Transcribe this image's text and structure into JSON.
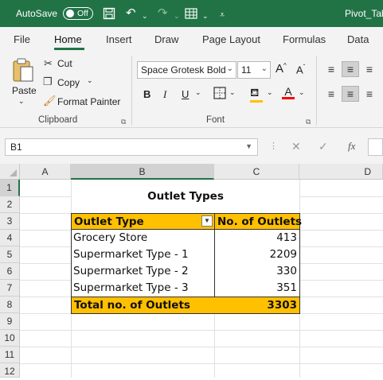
{
  "titlebar": {
    "autosave_label": "AutoSave",
    "autosave_state": "Off",
    "document_title": "Pivot_Tab"
  },
  "tabs": [
    "File",
    "Home",
    "Insert",
    "Draw",
    "Page Layout",
    "Formulas",
    "Data"
  ],
  "active_tab": "Home",
  "ribbon": {
    "clipboard": {
      "paste": "Paste",
      "cut": "Cut",
      "copy": "Copy",
      "format_painter": "Format Painter",
      "label": "Clipboard"
    },
    "font": {
      "font_name": "Space Grotesk Bold",
      "font_size": "11",
      "bold": "B",
      "italic": "I",
      "underline": "U",
      "font_color_glyph": "A",
      "grow_glyph": "A",
      "shrink_glyph": "A",
      "label": "Font"
    }
  },
  "formula_bar": {
    "name_box": "B1",
    "fx": "fx",
    "value": ""
  },
  "columns": [
    "A",
    "B",
    "C",
    "D"
  ],
  "rows": [
    "1",
    "2",
    "3",
    "4",
    "5",
    "6",
    "7",
    "8",
    "9",
    "10",
    "11",
    "12"
  ],
  "sheet": {
    "title": "Outlet Types",
    "header": {
      "col1": "Outlet Type",
      "col2": "No. of Outlets"
    },
    "rows": [
      {
        "type": "Grocery Store",
        "count": "413"
      },
      {
        "type": "Supermarket Type - 1",
        "count": "2209"
      },
      {
        "type": "Supermarket Type - 2",
        "count": "330"
      },
      {
        "type": "Supermarket Type - 3",
        "count": "351"
      }
    ],
    "total": {
      "label": "Total no. of Outlets",
      "value": "3303"
    }
  },
  "colors": {
    "title_bar": "#217346",
    "header_fill": "#ffc000",
    "total_fill": "#ffc000"
  }
}
